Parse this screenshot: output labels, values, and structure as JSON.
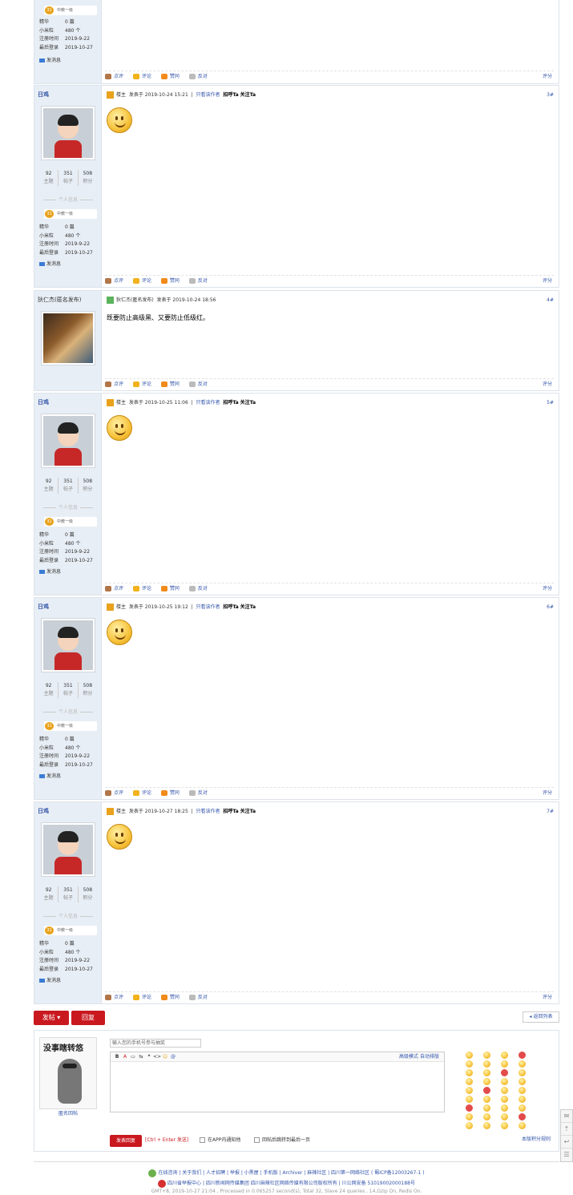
{
  "post_actions": {
    "comment": "点评",
    "review": "评论",
    "like": "赞同",
    "dislike": "反对",
    "rate": "评分"
  },
  "user_labels": {
    "threads": "主题",
    "posts": "帖子",
    "points": "积分",
    "personal_info": "个人信息",
    "digest": "精华",
    "mibi": "小米粒",
    "reg_time": "注册时间",
    "last_login": "最后登录",
    "send_msg": "发消息"
  },
  "top_partial": {
    "level_num": "31",
    "level_name": "中教一级",
    "digest": "0 篇",
    "mibi": "480 个",
    "reg_time": "2019-9-22",
    "last_login": "2019-10-27"
  },
  "posts": [
    {
      "author": "日鸡",
      "floor_tag": "楼主",
      "time": "发表于 2019-10-24 15:21",
      "only_author": "只看该作者",
      "greet": "招呼Ta",
      "follow": "关注Ta",
      "floor": "3#",
      "stats": [
        "92",
        "351",
        "508"
      ],
      "level_num": "31",
      "level_name": "中教一级",
      "digest": "0 篇",
      "mibi": "480 个",
      "reg_time": "2019-9-22",
      "last_login": "2019-10-27"
    },
    {
      "author": "狄仁杰(匿名发布)",
      "header_name": "狄仁杰(匿名发布)",
      "time": "发表于 2019-10-24 18:56",
      "floor": "4#",
      "content": "既要防止高级黑、又要防止低级红。"
    },
    {
      "author": "日鸡",
      "floor_tag": "楼主",
      "time": "发表于 2019-10-25 11:06",
      "only_author": "只看该作者",
      "greet": "招呼Ta",
      "follow": "关注Ta",
      "floor": "5#",
      "stats": [
        "92",
        "351",
        "508"
      ],
      "level_num": "31",
      "level_name": "中教一级",
      "digest": "0 篇",
      "mibi": "480 个",
      "reg_time": "2019-9-22",
      "last_login": "2019-10-27"
    },
    {
      "author": "日鸡",
      "floor_tag": "楼主",
      "time": "发表于 2019-10-25 19:12",
      "only_author": "只看该作者",
      "greet": "招呼Ta",
      "follow": "关注Ta",
      "floor": "6#",
      "stats": [
        "92",
        "351",
        "508"
      ],
      "level_num": "31",
      "level_name": "中教一级",
      "digest": "0 篇",
      "mibi": "480 个",
      "reg_time": "2019-9-22",
      "last_login": "2019-10-27"
    },
    {
      "author": "日鸡",
      "floor_tag": "楼主",
      "time": "发表于 2019-10-27 18:25",
      "only_author": "只看该作者",
      "greet": "招呼Ta",
      "follow": "关注Ta",
      "floor": "7#",
      "stats": [
        "92",
        "351",
        "508"
      ],
      "level_num": "31",
      "level_name": "中教一级",
      "digest": "0 篇",
      "mibi": "480 个",
      "reg_time": "2019-9-22",
      "last_login": "2019-10-27"
    }
  ],
  "bottom_buttons": {
    "post": "发帖",
    "reply": "回复",
    "back": "返回列表"
  },
  "reply_box": {
    "anon_title": "没事瞎转悠",
    "anon_label": "匿名回帖",
    "phone_placeholder": "输入您的手机号参与抽奖",
    "toolbar": [
      "B",
      "A",
      "▭",
      "⇆",
      "❝",
      "<>",
      "☺",
      "@"
    ],
    "advanced": "高级模式",
    "auto_layout": "自动排版",
    "submit": "发表回复",
    "shortcut": "[Ctrl + Enter 发送]",
    "notify": "在APP内通知他",
    "jump_last": "回帖后跳转到最后一页",
    "rules": "本版积分规则"
  },
  "footer": {
    "line1": "在线咨询 | 关于我们 | 人才招聘 | 举报 | 小黑屋 | 手机版 | Archiver | 麻辣社区 | 四川第一网络社区 ( 蜀ICP备12003267-1 )",
    "line2": "四川省举报中心 | 四川新闻网传媒集团 四川麻辣社区网络传媒有限公司版权所有 | 川公网安备 51019002000188号",
    "line3": "GMT+8, 2019-10-27 21:04 , Processed in 0.065257 second(s), Total 32, Slave 24 queries , 14,Gzip On, Redis On."
  },
  "colors": {
    "accent_red": "#c9191f",
    "link_blue": "#3355aa",
    "side_bg": "#e8eef5"
  },
  "float_icons": [
    "chat-icon",
    "top-icon",
    "return-icon",
    "list-icon"
  ]
}
